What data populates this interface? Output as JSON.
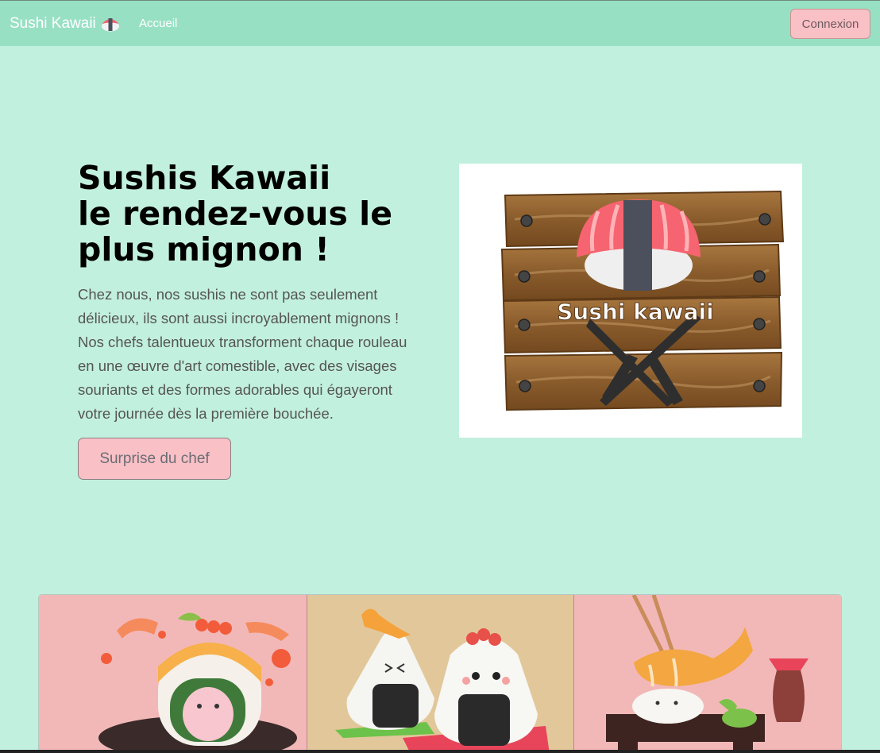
{
  "navbar": {
    "brand": "Sushi Kawaii",
    "brand_icon": "sushi-icon",
    "links": [
      "Accueil"
    ],
    "login_label": "Connexion"
  },
  "hero": {
    "title_lines": [
      "Sushis Kawaii",
      "le rendez-vous le",
      "plus mignon !"
    ],
    "text": "Chez nous, nos sushis ne sont pas seulement délicieux, ils sont aussi incroyablement mignons ! Nos chefs talentueux transforment chaque rouleau en une œuvre d'art comestible, avec des visages souriants et des formes adorables qui égayeront votre journée dès la première bouchée.",
    "cta_label": "Surprise du chef"
  },
  "logo": {
    "text": "Sushi kawaii"
  },
  "gallery": {
    "items": [
      "sushi-roll-image",
      "onigiri-image",
      "shrimp-nigiri-image"
    ]
  },
  "colors": {
    "background": "#c2f0de",
    "navbar": "#98e0c4",
    "button_pink": "#f9c0c6"
  }
}
